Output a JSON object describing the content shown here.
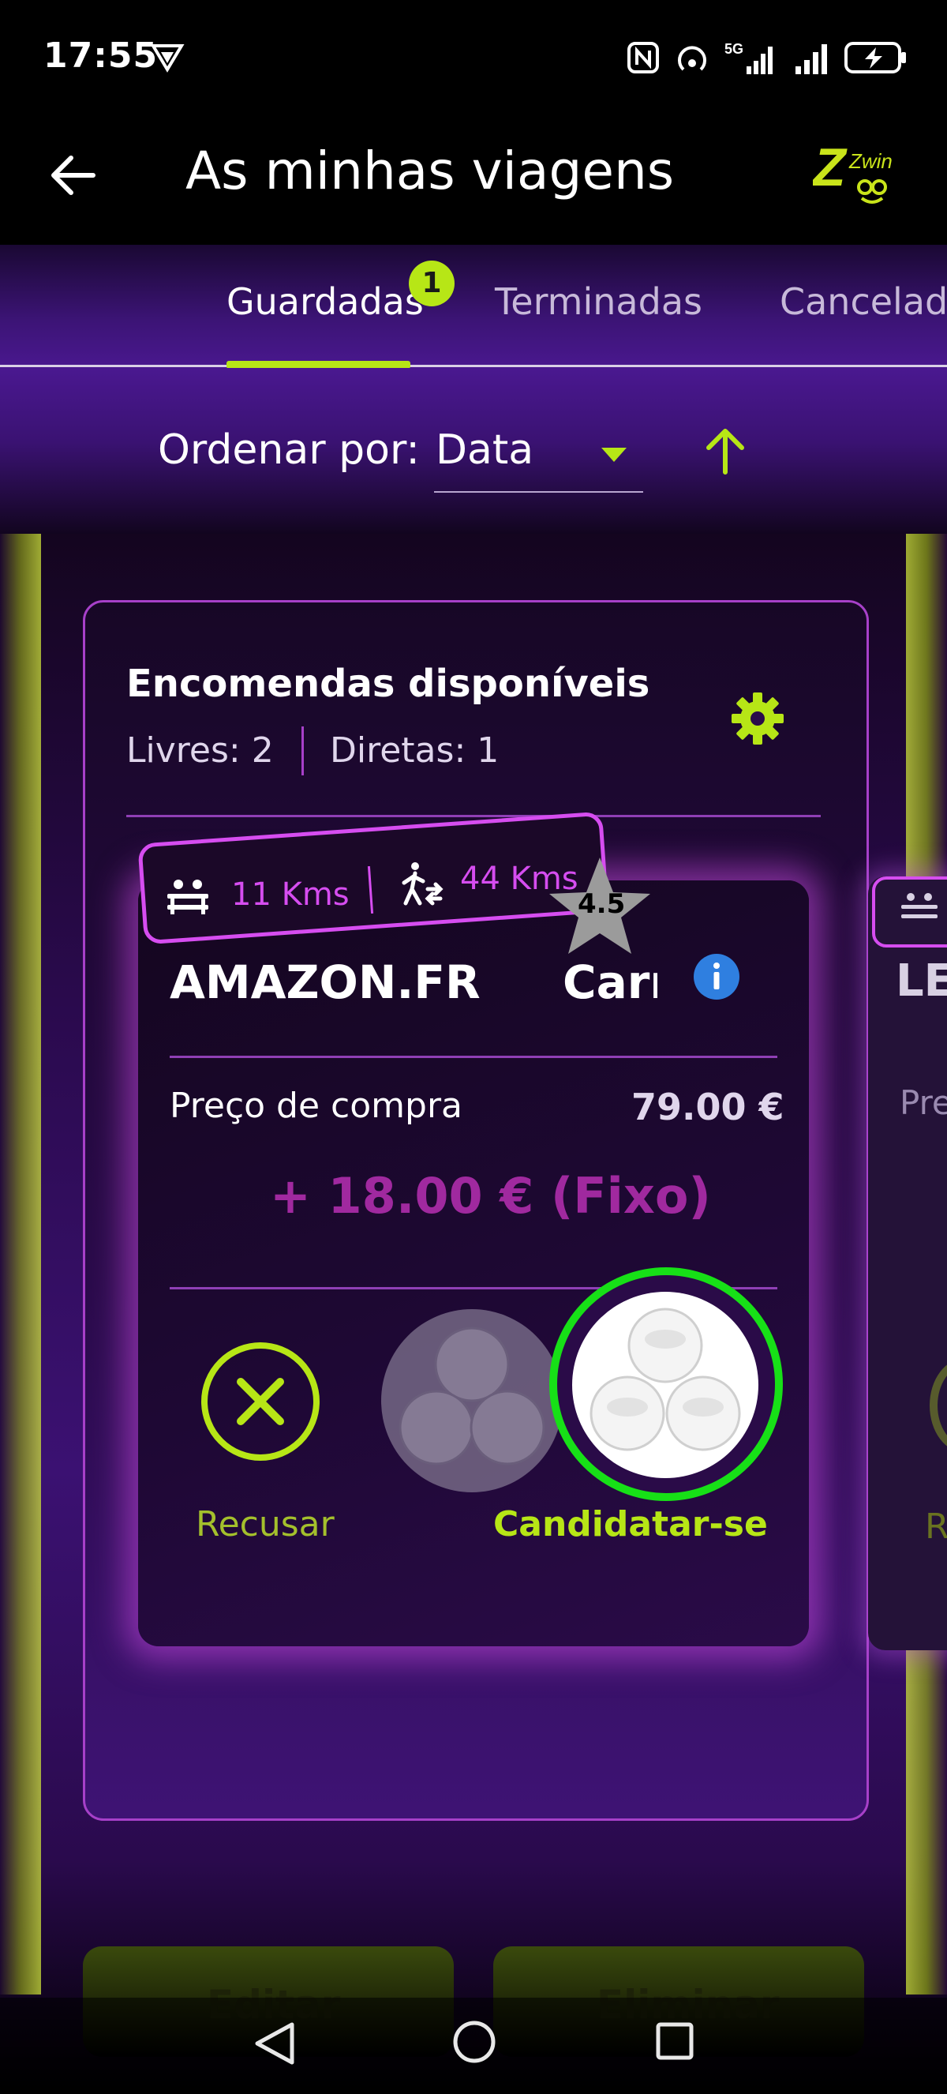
{
  "status_bar": {
    "time": "17:55",
    "network": "5G"
  },
  "header": {
    "title": "As minhas viagens",
    "logo_text": "Zwin"
  },
  "tabs": [
    {
      "label": "Guardadas",
      "badge": "1",
      "active": true
    },
    {
      "label": "Terminadas",
      "active": false
    },
    {
      "label": "Canceladas",
      "active": false
    }
  ],
  "sort": {
    "label": "Ordenar por:",
    "value": "Data"
  },
  "card": {
    "title": "Encomendas disponíveis",
    "livres": "Livres: 2",
    "diretas": "Diretas: 1"
  },
  "order": {
    "distance_vehicle": "11 Kms",
    "distance_walk": "44 Kms",
    "rating": "4.5",
    "store": "AMAZON.FR",
    "vehicle": "Carro",
    "purchase_label": "Preço de compra",
    "purchase_value": "79.00 €",
    "fee": "+ 18.00 € (Fixo)",
    "decline_label": "Recusar",
    "apply_label": "Candidatar-se"
  },
  "side_card": {
    "title": "LE",
    "price_label": "Pre",
    "action": "R"
  },
  "bottom_buttons": {
    "edit": "Editar",
    "delete": "Eliminar"
  },
  "colors": {
    "accent_green": "#b7e616",
    "accent_magenta": "#d64df0",
    "purple_bg": "#3b1172",
    "apply_ring": "#17e017"
  }
}
